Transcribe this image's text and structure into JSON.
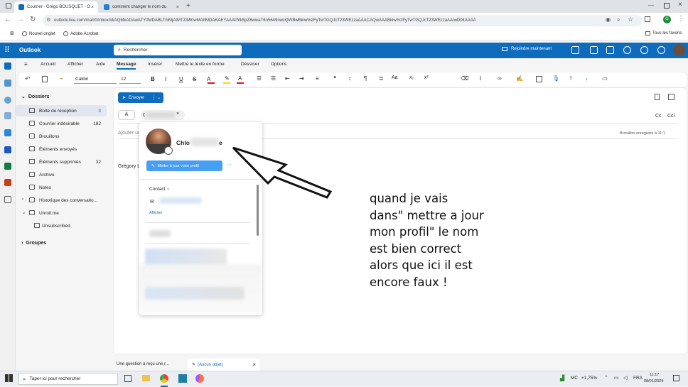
{
  "browser": {
    "tabs": [
      {
        "title": "Courrier - Grégo BOUSQUET - O",
        "icon": "outlook-icon",
        "color": "#0f6cbd",
        "active": true
      },
      {
        "title": "comment changer le nom du",
        "icon": "bing-icon",
        "color": "#2b7bd9",
        "active": false
      }
    ],
    "url": "outlook.live.com/mail/0/inbox/id/AQMkADAwATY0MDABLThiMjAtMTZiMi0wMAItMDAKAEYAAAPVk5pZ8wwaT6n5649nwcQWBwBkiw%2FyTwTGQJcT23WEzzaAAACAQwAAABkiw%2FyTwTGQJcT23WEzzaAAIwD0itAAAA",
    "bookmarks": [
      "Nouvel onglet",
      "Adobe Acrobat"
    ],
    "all_bookmarks": "Tous les favoris"
  },
  "outlook": {
    "app_name": "Outlook",
    "search_placeholder": "Rechercher",
    "meeting_label": "Rejoindre maintenant",
    "user_initial": "G",
    "menu_tabs": [
      "Accueil",
      "Afficher",
      "Aide",
      "Message",
      "Insérer",
      "Mettre le texte en forme",
      "Dessiner",
      "Options"
    ],
    "active_tab": "Message",
    "font_name": "Calibri",
    "font_size": "12"
  },
  "folders": {
    "header": "Dossiers",
    "items": [
      {
        "label": "Boîte de réception",
        "count": "3",
        "icon": "inbox-icon"
      },
      {
        "label": "Courrier indésirable",
        "count": "182",
        "icon": "junk-icon"
      },
      {
        "label": "Brouillons",
        "count": "",
        "icon": "draft-icon"
      },
      {
        "label": "Éléments envoyés",
        "count": "",
        "icon": "sent-icon"
      },
      {
        "label": "Éléments supprimés",
        "count": "32",
        "icon": "trash-icon"
      },
      {
        "label": "Archive",
        "count": "",
        "icon": "archive-icon"
      },
      {
        "label": "Notes",
        "count": "",
        "icon": "notes-icon"
      },
      {
        "label": "Historique des conversatio...",
        "count": "",
        "icon": "history-icon"
      },
      {
        "label": "Unroll.me",
        "count": "",
        "icon": "folder-icon"
      },
      {
        "label": "Unsubscribed",
        "count": "",
        "icon": "folder-icon"
      }
    ],
    "groups": "Groupes"
  },
  "compose": {
    "send_label": "Envoyer",
    "to_label": "À",
    "cc_label": "Cc",
    "cci_label": "Cci",
    "subject_placeholder": "Ajouter un objet",
    "saved_status": "Brouillon enregistré à 11:1",
    "signature": "Grégory L"
  },
  "card": {
    "name_visible": "Chlo",
    "name_suffix": "e",
    "update_btn": "Mettre à jour votre profil",
    "more": "···",
    "contact_header": "Contact",
    "show_more": "Afficher"
  },
  "bottom_tabs": [
    "Une question a reçu une r...",
    "(Aucun objet)"
  ],
  "annotation": [
    "quand je vais",
    "dans\" mettre a jour",
    "mon profil\" le nom",
    "est bien correct",
    "alors que ici il est",
    "encore faux !"
  ],
  "taskbar": {
    "search_placeholder": "Taper ici pour rechercher",
    "market": "MC",
    "market_change": "+1,75%",
    "lang": "FRA",
    "time": "11:17",
    "date": "08/01/2025"
  }
}
